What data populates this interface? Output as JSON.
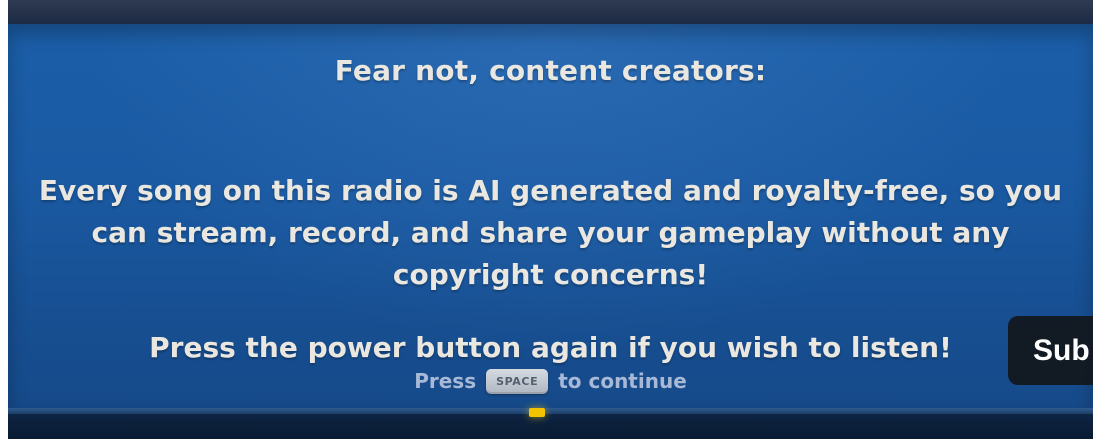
{
  "dialog": {
    "headline": "Fear not, content creators:",
    "body": "Every song on this radio is AI generated and royalty-free, so you can stream, record, and share your gameplay without any copyright concerns!",
    "power_hint": "Press the power button again if you wish to listen!"
  },
  "prompt": {
    "press_label": "Press",
    "key_label": "SPACE",
    "continue_label": "to continue"
  },
  "player_overlay": {
    "subtitles_button_label": "Sub"
  },
  "colors": {
    "panel_blue": "#1a5aa3",
    "accent_yellow": "#f2c300",
    "text": "#e9e7df"
  }
}
